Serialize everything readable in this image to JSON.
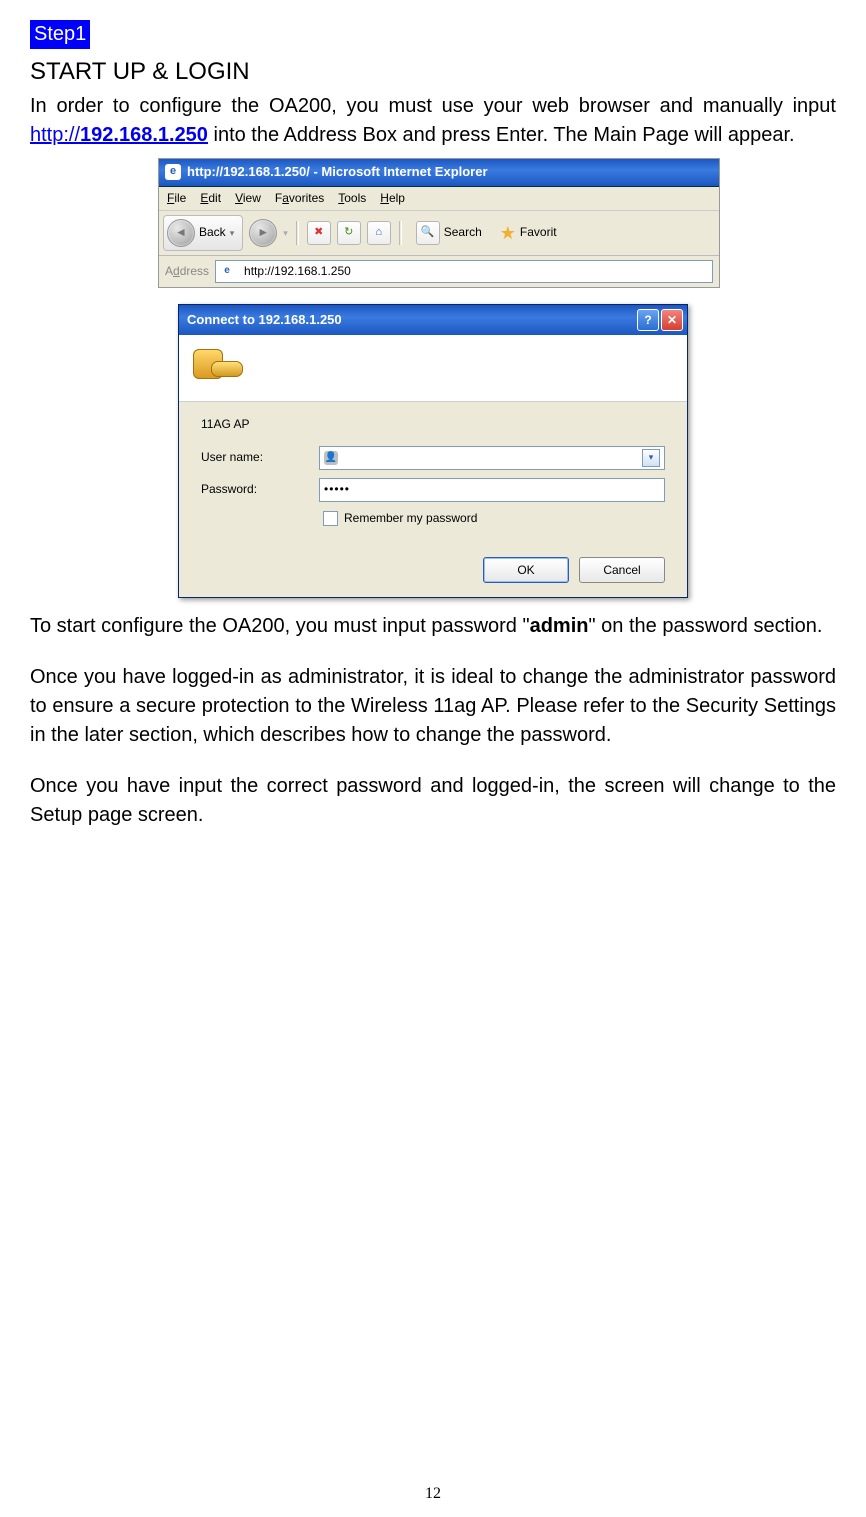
{
  "step_label": "Step1",
  "heading": "START UP & LOGIN",
  "intro_prefix": "In order to configure the OA200, you must use your web browser and manually input ",
  "url_proto": "http://",
  "url_host": "192.168.1.250",
  "intro_suffix": "  into the Address Box and press Enter. The Main Page will appear.",
  "browser": {
    "title": "http://192.168.1.250/ - Microsoft Internet Explorer",
    "menu_file": "File",
    "menu_edit": "Edit",
    "menu_view": "View",
    "menu_fav": "Favorites",
    "menu_tools": "Tools",
    "menu_help": "Help",
    "back": "Back",
    "search": "Search",
    "favorit": "Favorit",
    "address_label": "Address",
    "address_value": "http://192.168.1.250"
  },
  "dialog": {
    "title": "Connect to 192.168.1.250",
    "realm": "11AG AP",
    "user_label": "User name:",
    "pass_label": "Password:",
    "pass_value": "•••••",
    "remember": "Remember my password",
    "ok": "OK",
    "cancel": "Cancel"
  },
  "para2_prefix": "To start configure the OA200, you must input password \"",
  "para2_bold": "admin",
  "para2_suffix": "\" on the password section.",
  "para3": "Once you have logged-in as administrator, it is ideal to change the administrator password to ensure a secure protection to the Wireless 11ag AP. Please refer to the Security Settings in the later section, which describes how to change the password.",
  "para4": "Once you have input the correct password and logged-in, the screen will change to the Setup page screen.",
  "page_number": "12"
}
